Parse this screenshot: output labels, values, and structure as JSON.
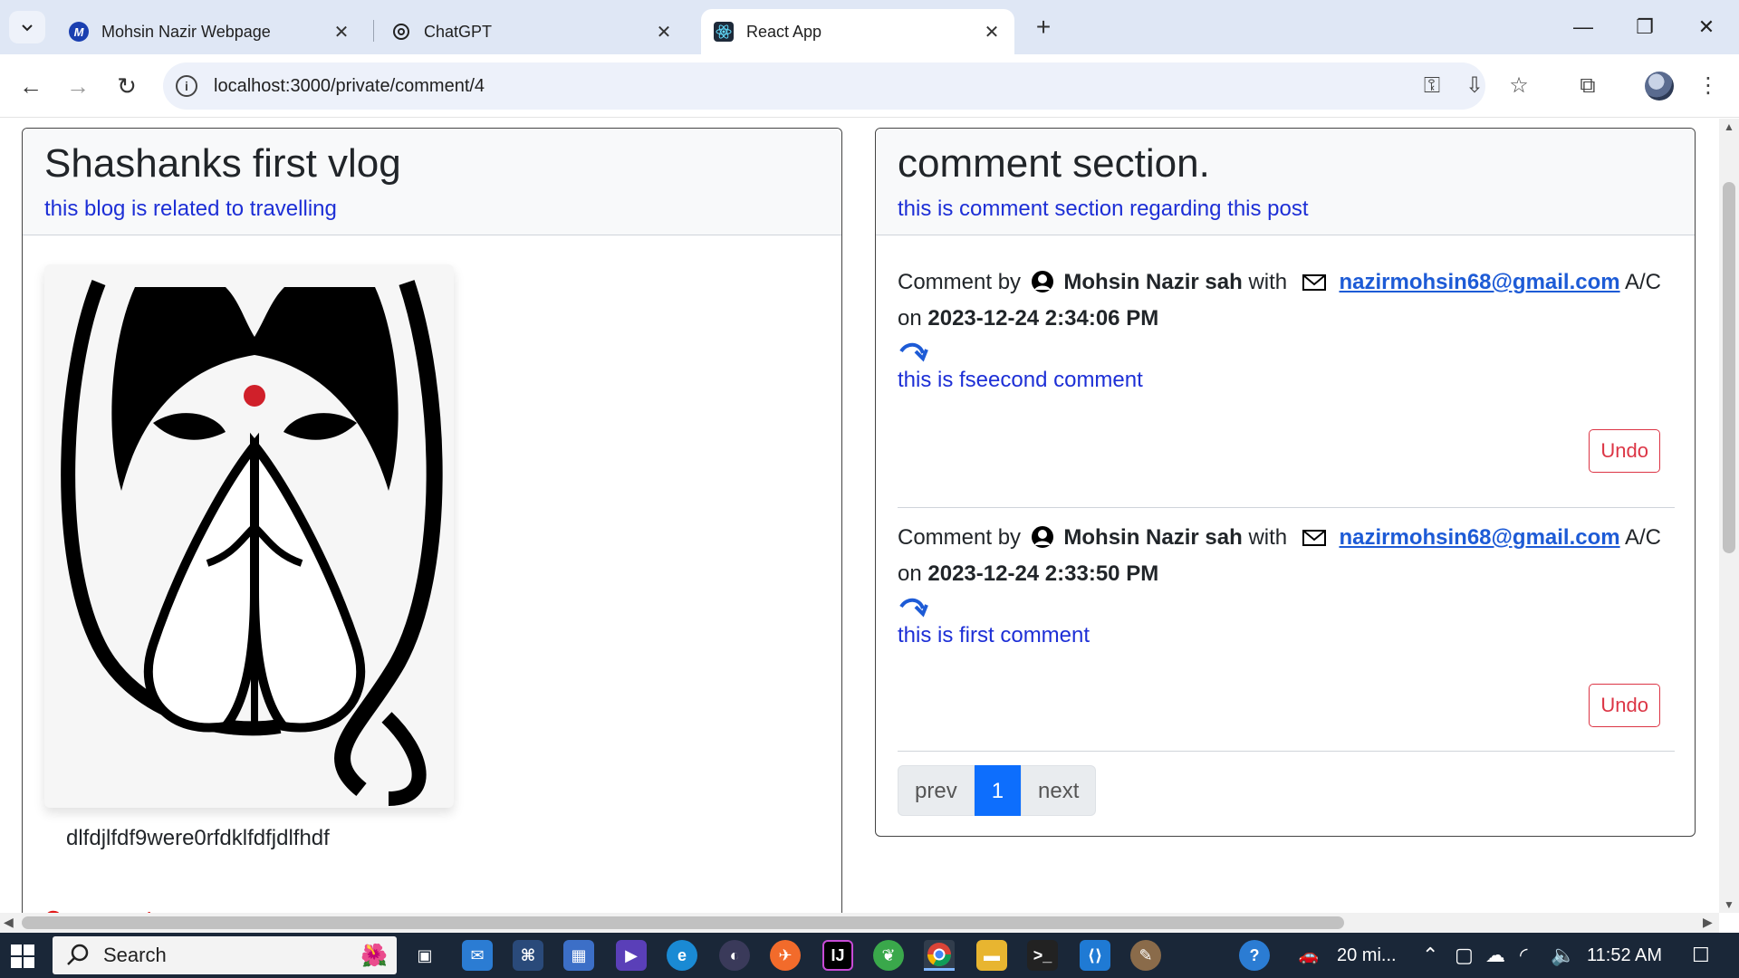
{
  "browser": {
    "tabs": [
      {
        "title": "Mohsin Nazir Webpage",
        "favicon": "M"
      },
      {
        "title": "ChatGPT",
        "favicon": "chatgpt-logo"
      },
      {
        "title": "React App",
        "favicon": "react-logo"
      }
    ],
    "url": "localhost:3000/private/comment/4"
  },
  "post": {
    "title": "Shashanks first vlog",
    "subtitle": "this blog is related to travelling",
    "image": "namaste-woman-illustration",
    "content": "dlfdjlfdf9were0rfdklfdfjdlfhdf",
    "comment_heading": "Comment"
  },
  "comments_section": {
    "title": "comment section.",
    "subtitle": "this is comment section regarding this post",
    "comments": [
      {
        "prefix": "Comment by",
        "author": "Mohsin Nazir sah",
        "with": "with",
        "email": "nazirmohsin68@gmail.com",
        "suffix": "A/C",
        "on": "on",
        "date": "2023-12-24 2:34:06 PM",
        "text": "this is fseecond comment",
        "undo_label": "Undo"
      },
      {
        "prefix": "Comment by",
        "author": "Mohsin Nazir sah",
        "with": "with",
        "email": "nazirmohsin68@gmail.com",
        "suffix": "A/C",
        "on": "on",
        "date": "2023-12-24 2:33:50 PM",
        "text": "this is first comment",
        "undo_label": "Undo"
      }
    ],
    "pagination": {
      "prev": "prev",
      "current": "1",
      "next": "next"
    }
  },
  "taskbar": {
    "search_label": "Search",
    "weather": "20 mi...",
    "time": "11:52 AM"
  },
  "colors": {
    "accent_blue": "#0d6efd",
    "subtitle_blue": "#1d2fd6",
    "danger": "#dc3545",
    "link": "#1d5bd6"
  }
}
